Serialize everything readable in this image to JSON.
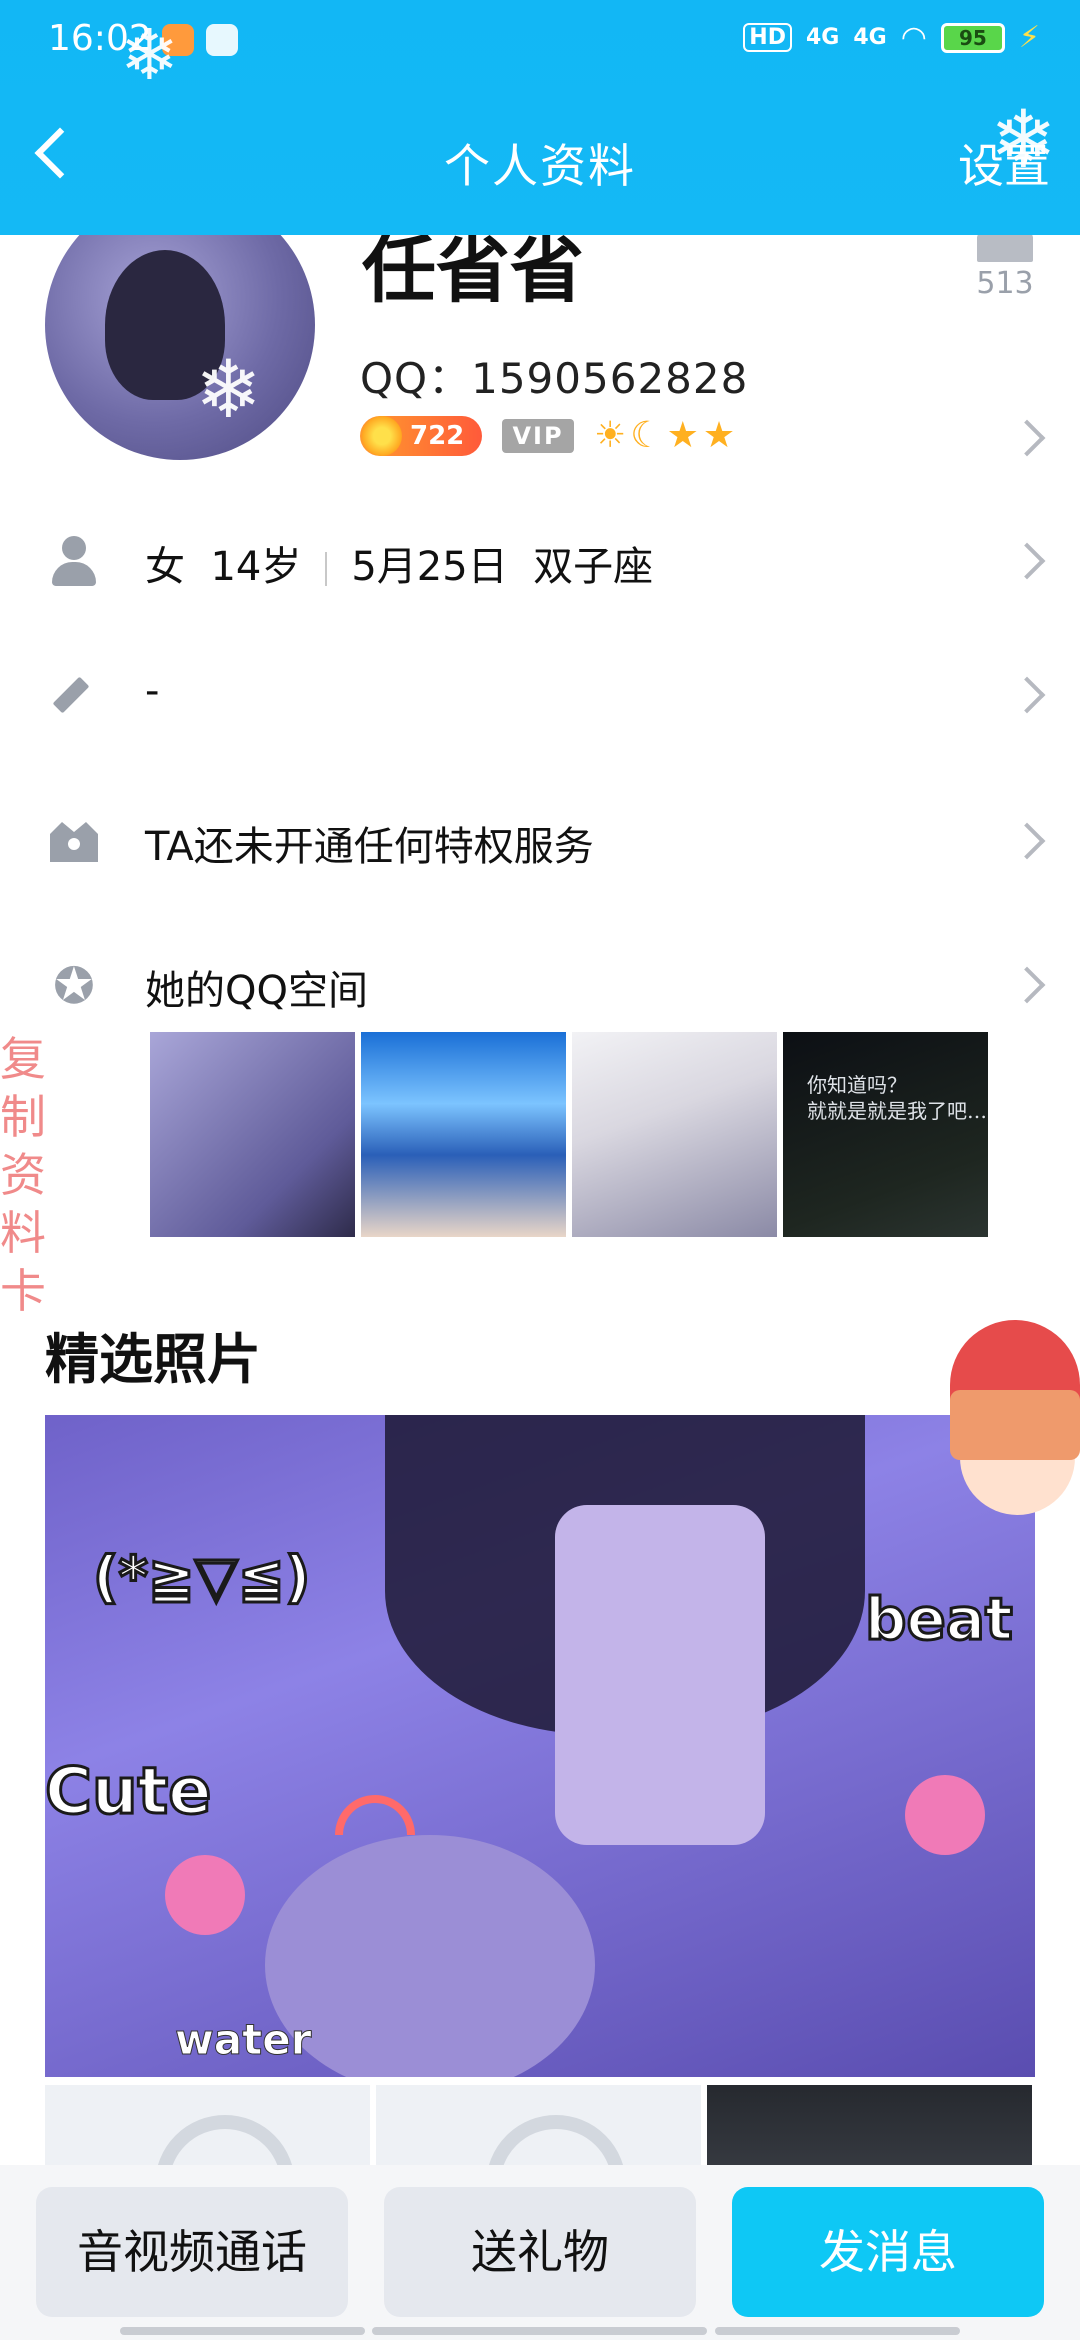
{
  "status_bar": {
    "time": "16:02",
    "hd": "HD",
    "signal1": "4G",
    "signal2": "4G",
    "battery": "95"
  },
  "header": {
    "title": "个人资料",
    "settings": "设置"
  },
  "profile": {
    "nickname": "任省省",
    "like_count": "513",
    "qq": "QQ：1590562828",
    "level_number": "722",
    "vip_label": "VIP"
  },
  "info_rows": {
    "basic": {
      "gender": "女",
      "age": "14岁",
      "birthday": "5月25日",
      "zodiac": "双子座"
    },
    "signature": "-",
    "privilege": "TA还未开通任何特权服务",
    "qzone": "她的QQ空间"
  },
  "qzone_thumbs": {
    "thumb4_text_line1": "你知道吗？",
    "thumb4_text_line2": "就就是就是我了吧…"
  },
  "side_label": "复制资料卡",
  "featured": {
    "title": "精选照片",
    "overlay_kaomoji": "(*≧▽≦)",
    "overlay_cute": "Cute",
    "overlay_beat": "beat",
    "overlay_water": "water"
  },
  "bottom_bar": {
    "call": "音视频通话",
    "gift": "送礼物",
    "message": "发消息"
  },
  "colors": {
    "header_blue": "#12b7f5",
    "primary_button": "#0ec8f5",
    "side_label": "#f08a8a"
  }
}
